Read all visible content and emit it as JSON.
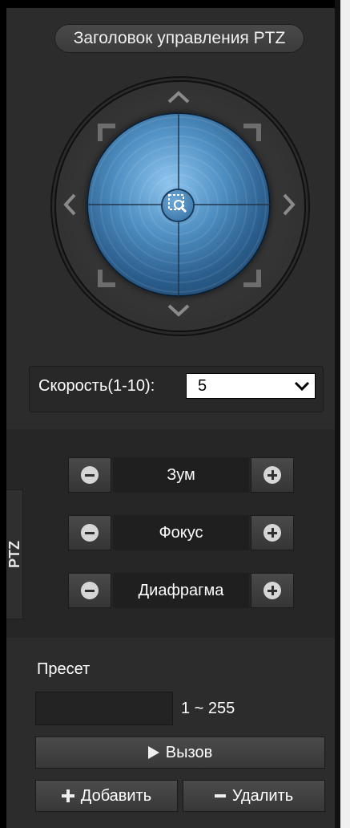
{
  "header": {
    "title": "Заголовок управления PTZ"
  },
  "ptz": {
    "icons": [
      "arrow-up-icon",
      "arrow-down-icon",
      "arrow-left-icon",
      "arrow-right-icon",
      "arrow-up-left-icon",
      "arrow-up-right-icon",
      "arrow-down-left-icon",
      "arrow-down-right-icon",
      "zoom-area-icon"
    ]
  },
  "speed": {
    "label": "Скорость(1-10):",
    "value": "5"
  },
  "side_tab": {
    "label": "PTZ"
  },
  "controls": [
    {
      "label": "Зум"
    },
    {
      "label": "Фокус"
    },
    {
      "label": "Диафрагма"
    }
  ],
  "preset": {
    "label": "Пресет",
    "value": "",
    "range": "1 ~ 255",
    "call_label": "Вызов",
    "add_label": "Добавить",
    "delete_label": "Удалить"
  },
  "colors": {
    "background": "#2c2c2c",
    "lens": "#4f8fc2",
    "text": "#ffffff"
  }
}
